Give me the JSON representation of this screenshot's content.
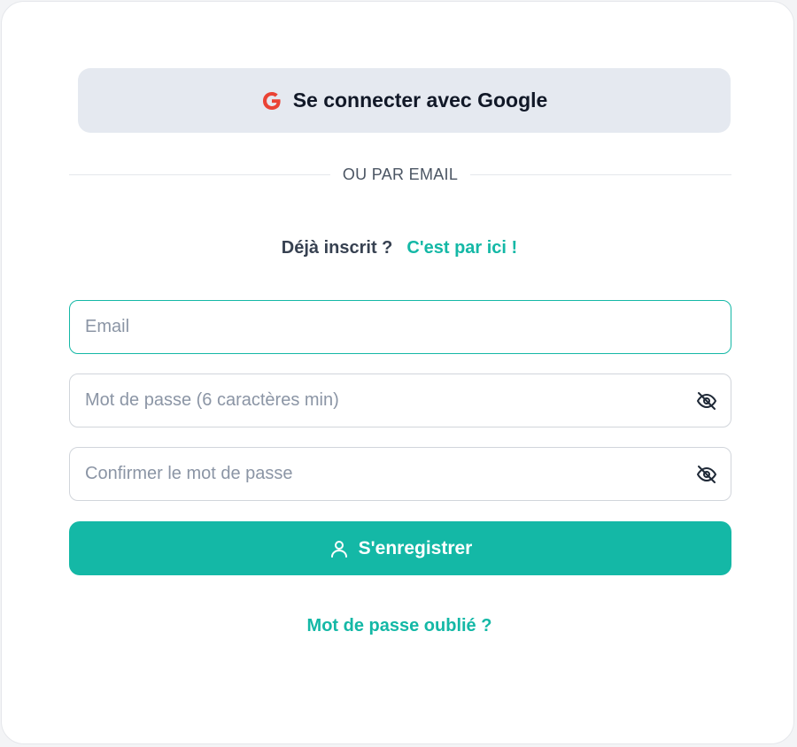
{
  "google_button": {
    "label": "Se connecter avec Google"
  },
  "divider": {
    "label": "OU PAR EMAIL"
  },
  "login_prompt": {
    "question": "Déjà inscrit ?",
    "link": "C'est par ici !"
  },
  "form": {
    "email": {
      "value": "",
      "placeholder": "Email"
    },
    "password": {
      "value": "",
      "placeholder": "Mot de passe (6 caractères min)",
      "icon": "eye-slash-icon"
    },
    "confirm_password": {
      "value": "",
      "placeholder": "Confirmer le mot de passe",
      "icon": "eye-slash-icon"
    },
    "submit": {
      "label": "S'enregistrer",
      "icon": "user-icon"
    }
  },
  "forgot_password": {
    "label": "Mot de passe oublié ?"
  },
  "colors": {
    "accent": "#14b8a6",
    "google_red": "#ea4335",
    "google_button_bg": "#e5e9f0"
  }
}
